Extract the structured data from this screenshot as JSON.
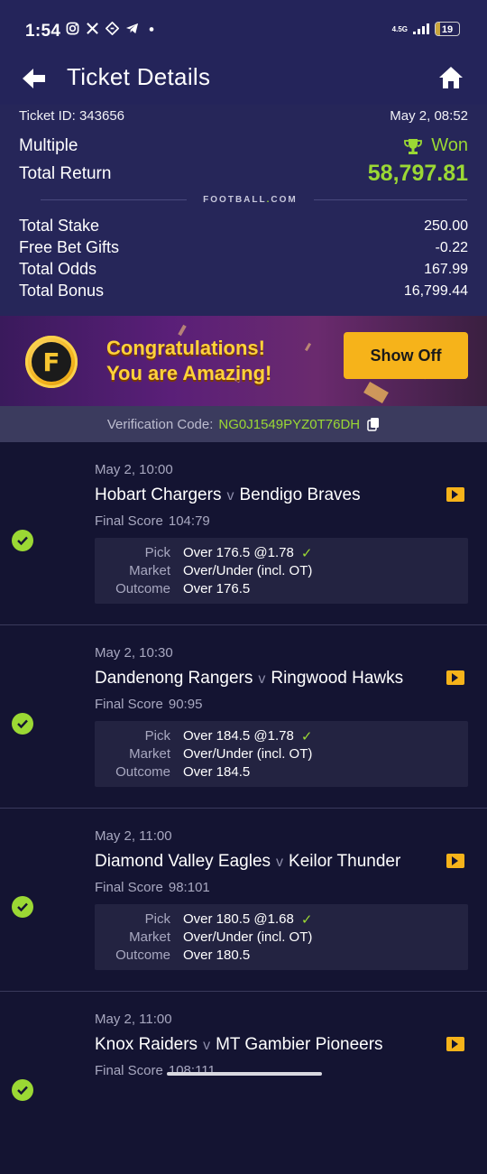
{
  "status_bar": {
    "time": "1:54",
    "icons": [
      "instagram-icon",
      "x-icon",
      "app-icon",
      "telegram-icon",
      "dot-icon"
    ],
    "network": "4.5G",
    "battery": "19",
    "battery_level": 0.19
  },
  "header": {
    "title": "Ticket Details"
  },
  "ticket": {
    "id_label": "Ticket ID: 343656",
    "datetime": "May 2, 08:52",
    "type": "Multiple",
    "status": "Won",
    "total_return_label": "Total Return",
    "total_return": "58,797.81",
    "brand": "FOOTBALL",
    "brand_tld": "COM",
    "total_stake_label": "Total Stake",
    "total_stake": "250.00",
    "free_bet_label": "Free Bet Gifts",
    "free_bet": "-0.22",
    "total_odds_label": "Total Odds",
    "total_odds": "167.99",
    "total_bonus_label": "Total Bonus",
    "total_bonus": "16,799.44"
  },
  "banner": {
    "line1": "Congratulations!",
    "line2": "You are Amazing!",
    "button": "Show Off"
  },
  "verification": {
    "label": "Verification Code:",
    "code": "NG0J1549PYZ0T76DH"
  },
  "labels": {
    "final_score": "Final Score",
    "pick": "Pick",
    "market": "Market",
    "outcome": "Outcome",
    "vs": "v"
  },
  "matches": [
    {
      "date": "May 2, 10:00",
      "home": "Hobart Chargers",
      "away": "Bendigo Braves",
      "score": "104:79",
      "pick": "Over 176.5 @1.78",
      "market": "Over/Under (incl. OT)",
      "outcome": "Over 176.5"
    },
    {
      "date": "May 2, 10:30",
      "home": "Dandenong Rangers",
      "away": "Ringwood Hawks",
      "score": "90:95",
      "pick": "Over 184.5 @1.78",
      "market": "Over/Under (incl. OT)",
      "outcome": "Over 184.5"
    },
    {
      "date": "May 2, 11:00",
      "home": "Diamond Valley Eagles",
      "away": "Keilor Thunder",
      "score": "98:101",
      "pick": "Over 180.5 @1.68",
      "market": "Over/Under (incl. OT)",
      "outcome": "Over 180.5"
    },
    {
      "date": "May 2, 11:00",
      "home": "Knox Raiders",
      "away": "MT Gambier Pioneers",
      "score": "108:111"
    }
  ],
  "colors": {
    "header_bg": "#24245a",
    "summary_bg": "#262659",
    "page_bg": "#141432",
    "accent_green": "#9bd834",
    "accent_yellow": "#f6b31a"
  }
}
